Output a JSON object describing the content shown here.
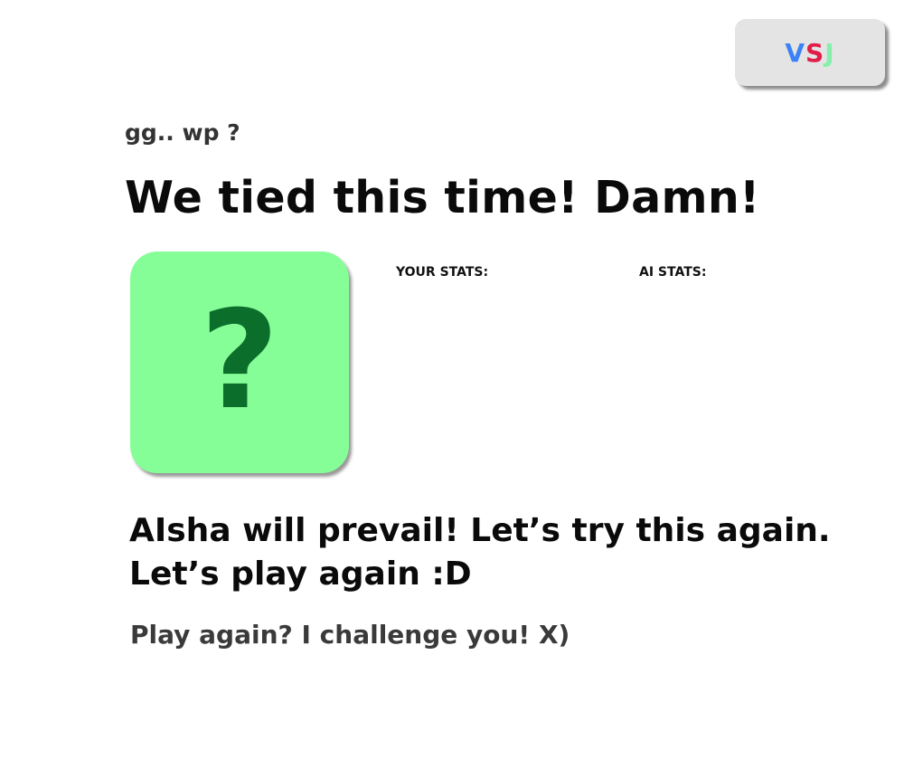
{
  "logo": {
    "letters": [
      "V",
      "S",
      "J"
    ],
    "colors": [
      "#3b82f6",
      "#e11d48",
      "#86efac"
    ],
    "background": "#e4e4e4"
  },
  "subtitle": "gg.. wp ?",
  "headline": "We tied this time! Damn!",
  "result_card": {
    "symbol": "?",
    "background": "#86fe98",
    "symbol_color": "#0b6e2a",
    "icon": "question-mark-icon"
  },
  "stats": {
    "your_label": "YOUR STATS:",
    "ai_label": "AI STATS:"
  },
  "message": {
    "line1": "AIsha will prevail! Let’s try this again.",
    "line2": "Let’s play again :D"
  },
  "play_again": "Play again? I challenge you! X)"
}
